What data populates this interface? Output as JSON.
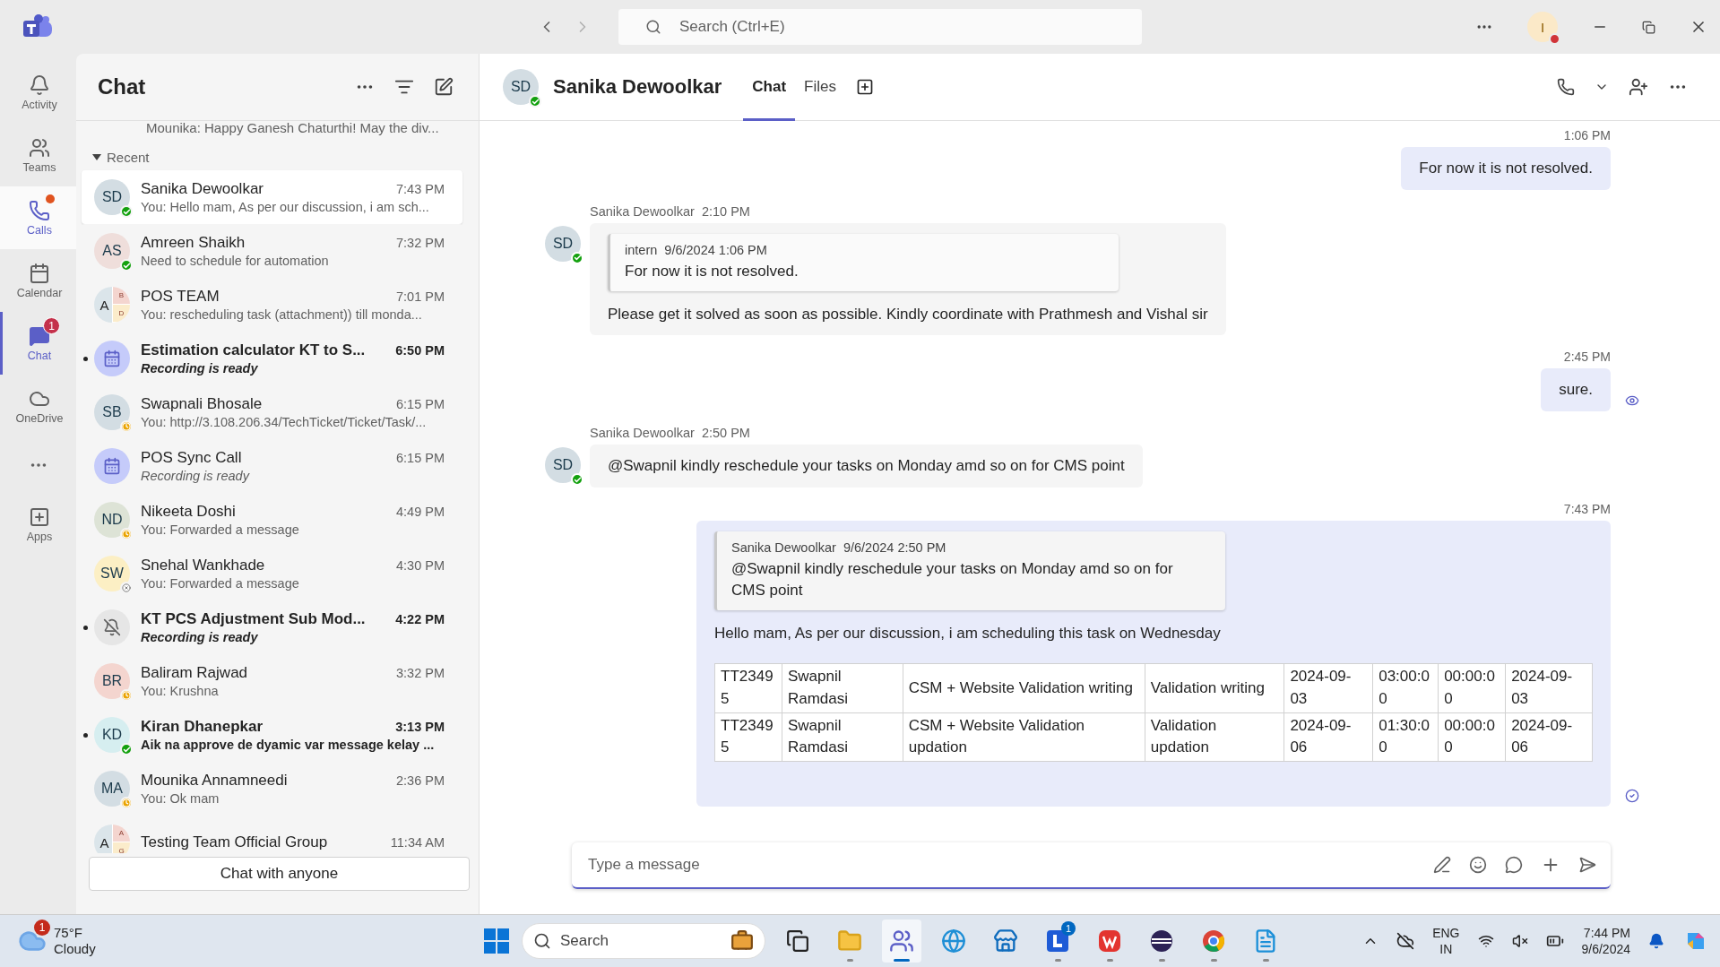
{
  "titlebar": {
    "search_placeholder": "Search (Ctrl+E)",
    "profile_initial": "I",
    "profile_presence": {
      "kind": "busy"
    }
  },
  "rail": [
    {
      "label": "Activity",
      "selected": false,
      "highlighted": false,
      "dot": false
    },
    {
      "label": "Teams",
      "selected": false,
      "highlighted": false,
      "dot": false
    },
    {
      "label": "Calls",
      "selected": false,
      "highlighted": true,
      "dot": true
    },
    {
      "label": "Calendar",
      "selected": false,
      "highlighted": false,
      "dot": false
    },
    {
      "label": "Chat",
      "selected": true,
      "highlighted": false,
      "dot": false,
      "badge": "1"
    },
    {
      "label": "OneDrive",
      "selected": false,
      "highlighted": false,
      "dot": false
    },
    {
      "label": "Apps",
      "selected": false,
      "highlighted": false,
      "dot": false
    }
  ],
  "chat_list": {
    "title": "Chat",
    "cut_preview": "Mounika: Happy Ganesh Chaturthi! May the div...",
    "section": "Recent",
    "section_expanded": true,
    "items": [
      {
        "kind": "person",
        "initials": "SD",
        "color": "#d3dde3",
        "presence": {
          "kind": "available"
        },
        "name": "Sanika Dewoolkar",
        "time": "7:43 PM",
        "preview": "You: Hello mam, As per our discussion, i am sch...",
        "unread": false,
        "system": false,
        "selected": true
      },
      {
        "kind": "person",
        "initials": "AS",
        "color": "#efdedb",
        "presence": {
          "kind": "available"
        },
        "name": "Amreen Shaikh",
        "time": "7:32 PM",
        "preview": "Need to schedule for automation",
        "unread": false,
        "system": false,
        "selected": false
      },
      {
        "kind": "group",
        "members": [
          "A",
          "B",
          "D"
        ],
        "name": "POS TEAM",
        "time": "7:01 PM",
        "preview": "You: rescheduling task (attachment)) till monda...",
        "unread": false,
        "system": false,
        "selected": false
      },
      {
        "kind": "meeting",
        "name": "Estimation calculator KT to S...",
        "time": "6:50 PM",
        "preview": "Recording is ready",
        "unread": true,
        "system": true,
        "selected": false
      },
      {
        "kind": "person",
        "initials": "SB",
        "color": "#d3dde3",
        "presence": {
          "kind": "away"
        },
        "name": "Swapnali Bhosale",
        "time": "6:15 PM",
        "preview": "You: http://3.108.206.34/TechTicket/Ticket/Task/...",
        "unread": false,
        "system": false,
        "selected": false
      },
      {
        "kind": "meeting",
        "name": "POS Sync Call",
        "time": "6:15 PM",
        "preview": "Recording is ready",
        "unread": false,
        "system": true,
        "selected": false
      },
      {
        "kind": "person",
        "initials": "ND",
        "color": "#dde3d6",
        "presence": {
          "kind": "away"
        },
        "name": "Nikeeta Doshi",
        "time": "4:49 PM",
        "preview": "You: Forwarded a message",
        "unread": false,
        "system": false,
        "selected": false
      },
      {
        "kind": "person",
        "initials": "SW",
        "color": "#fcefc4",
        "presence": {
          "kind": "offline"
        },
        "name": "Snehal Wankhade",
        "time": "4:30 PM",
        "preview": "You: Forwarded a message",
        "unread": false,
        "system": false,
        "selected": false
      },
      {
        "kind": "muted",
        "name": "KT PCS Adjustment Sub Mod...",
        "time": "4:22 PM",
        "preview": "Recording is ready",
        "unread": true,
        "system": true,
        "selected": false
      },
      {
        "kind": "person",
        "initials": "BR",
        "color": "#f4d5cf",
        "presence": {
          "kind": "away"
        },
        "name": "Baliram Rajwad",
        "time": "3:32 PM",
        "preview": "You: Krushna",
        "unread": false,
        "system": false,
        "selected": false
      },
      {
        "kind": "person",
        "initials": "KD",
        "color": "#d6eef0",
        "presence": {
          "kind": "available"
        },
        "name": "Kiran Dhanepkar",
        "time": "3:13 PM",
        "preview": "Aik na approve de dyamic var message kelay ...",
        "unread": true,
        "system": false,
        "selected": false
      },
      {
        "kind": "person",
        "initials": "MA",
        "color": "#d3dde3",
        "presence": {
          "kind": "away"
        },
        "name": "Mounika Annamneedi",
        "time": "2:36 PM",
        "preview": "You: Ok mam",
        "unread": false,
        "system": false,
        "selected": false
      },
      {
        "kind": "group",
        "members": [
          "A",
          "A",
          "G"
        ],
        "name": "Testing Team Official Group",
        "time": "11:34 AM",
        "unread": false,
        "selected": false
      }
    ],
    "new_chat_button": "Chat with anyone"
  },
  "conversation": {
    "initials": "SD",
    "presence": {
      "kind": "available"
    },
    "name": "Sanika Dewoolkar",
    "tabs": [
      {
        "label": "Chat",
        "selected": true
      },
      {
        "label": "Files",
        "selected": false
      }
    ],
    "messages": [
      {
        "kind": "sent",
        "time": "1:06 PM",
        "text": "For now it is not resolved."
      },
      {
        "kind": "received",
        "sender": "Sanika Dewoolkar",
        "time": "2:10 PM",
        "initials": "SD",
        "quote": {
          "author": "intern",
          "timestamp": "9/6/2024 1:06 PM",
          "text": "For now it is not resolved."
        },
        "text": "Please get it solved as soon as possible. Kindly coordinate with Prathmesh and Vishal sir"
      },
      {
        "kind": "sent",
        "time": "2:45 PM",
        "text": "sure.",
        "receipt": {
          "kind": "seen"
        }
      },
      {
        "kind": "received",
        "sender": "Sanika Dewoolkar",
        "time": "2:50 PM",
        "initials": "SD",
        "text": "@Swapnil kindly reschedule your tasks on Monday amd so on for CMS point"
      },
      {
        "kind": "sent",
        "time": "7:43 PM",
        "quote": {
          "author": "Sanika Dewoolkar",
          "timestamp": "9/6/2024 2:50 PM",
          "text": "@Swapnil kindly reschedule your tasks on Monday amd so on for CMS point"
        },
        "text": "Hello mam, As per our discussion, i am scheduling this task on Wednesday",
        "receipt": {
          "kind": "sent"
        },
        "table": [
          [
            "TT2349 5",
            "Swapnil Ramdasi",
            "CSM + Website Validation writing",
            "Validation writing",
            "2024-09- 03",
            "03:00:0 0",
            "00:00:0 0",
            "2024-09- 03"
          ],
          [
            "TT2349 5",
            "Swapnil Ramdasi",
            "CSM + Website Validation updation",
            "Validation updation",
            "2024-09- 06",
            "01:30:0 0",
            "00:00:0 0",
            "2024-09- 06"
          ]
        ]
      }
    ],
    "compose_placeholder": "Type a message"
  },
  "taskbar": {
    "temperature": "75°F",
    "condition": "Cloudy",
    "weather_badge": "1",
    "search_placeholder": "Search",
    "apps": [
      {
        "running": false,
        "active": false
      },
      {
        "running": true,
        "active": false
      },
      {
        "running": true,
        "active": true
      },
      {
        "running": false,
        "active": false
      },
      {
        "running": false,
        "active": false
      },
      {
        "running": true,
        "active": false,
        "badge": "1"
      },
      {
        "running": true,
        "active": false
      },
      {
        "running": true,
        "active": false
      },
      {
        "running": true,
        "active": false
      },
      {
        "running": true,
        "active": false
      }
    ],
    "language": "ENG",
    "region": "IN",
    "time": "7:44 PM",
    "date": "9/6/2024"
  }
}
